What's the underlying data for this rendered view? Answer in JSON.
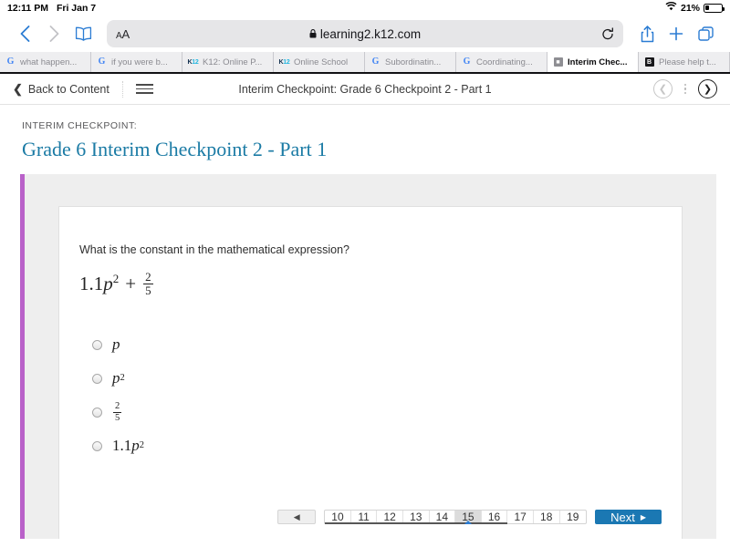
{
  "status_bar": {
    "time": "12:11 PM",
    "date": "Fri Jan 7",
    "wifi_icon": "wifi-icon",
    "battery_percent": "21%"
  },
  "browser": {
    "back_icon": "chevron-left-icon",
    "forward_icon": "chevron-right-icon",
    "bookmarks_icon": "book-icon",
    "reader_label": "AA",
    "lock_icon": "lock-icon",
    "url": "learning2.k12.com",
    "reload_icon": "reload-icon",
    "share_icon": "share-icon",
    "new_tab_icon": "plus-icon",
    "tabs_overview_icon": "tabs-icon",
    "tabs": [
      {
        "label": "what happen...",
        "favicon": "google-icon",
        "active": false
      },
      {
        "label": "if you were b...",
        "favicon": "google-icon",
        "active": false
      },
      {
        "label": "K12: Online P...",
        "favicon": "k12-icon",
        "active": false
      },
      {
        "label": "Online School",
        "favicon": "k12-icon",
        "active": false
      },
      {
        "label": "Subordinatin...",
        "favicon": "google-icon",
        "active": false
      },
      {
        "label": "Coordinating...",
        "favicon": "google-icon",
        "active": false
      },
      {
        "label": "Interim Chec...",
        "favicon": "square-icon",
        "active": true
      },
      {
        "label": "Please help t...",
        "favicon": "square-dark-icon",
        "active": false
      }
    ]
  },
  "app_nav": {
    "back_label": "Back to Content",
    "back_icon": "chevron-left-icon",
    "menu_icon": "hamburger-icon",
    "title": "Interim Checkpoint: Grade 6 Checkpoint 2 - Part 1",
    "prev_icon": "circle-chevron-left-icon",
    "more_icon": "kebab-menu-icon",
    "next_icon": "circle-chevron-right-icon"
  },
  "page_head": {
    "eyebrow": "INTERIM CHECKPOINT:",
    "title": "Grade 6 Interim Checkpoint 2 - Part 1",
    "accent_color": "#b961c9",
    "title_color": "#1b7ba5"
  },
  "question": {
    "prompt": "What is the constant in the mathematical expression?",
    "expression": {
      "coefficient": "1.1",
      "variable": "p",
      "exponent": "2",
      "operator": "+",
      "fraction_numerator": "2",
      "fraction_denominator": "5",
      "plain": "1.1p^2 + 2/5"
    },
    "options": [
      {
        "id": "a",
        "text": "p",
        "kind": "var",
        "selected": false
      },
      {
        "id": "b",
        "text": "p^2",
        "kind": "var-exp",
        "base": "p",
        "exponent": "2",
        "selected": false
      },
      {
        "id": "c",
        "text": "2/5",
        "kind": "fraction",
        "numerator": "2",
        "denominator": "5",
        "selected": false
      },
      {
        "id": "d",
        "text": "1.1p^2",
        "kind": "coef-var-exp",
        "coefficient": "1.1",
        "base": "p",
        "exponent": "2",
        "selected": false
      }
    ]
  },
  "pagination": {
    "prev_icon": "triangle-left-icon",
    "pages": [
      {
        "number": "10",
        "current": false,
        "visited": true
      },
      {
        "number": "11",
        "current": false,
        "visited": true
      },
      {
        "number": "12",
        "current": false,
        "visited": true
      },
      {
        "number": "13",
        "current": false,
        "visited": true
      },
      {
        "number": "14",
        "current": false,
        "visited": true
      },
      {
        "number": "15",
        "current": true,
        "visited": true
      },
      {
        "number": "16",
        "current": false,
        "visited": true
      },
      {
        "number": "17",
        "current": false,
        "visited": false
      },
      {
        "number": "18",
        "current": false,
        "visited": false
      },
      {
        "number": "19",
        "current": false,
        "visited": false
      }
    ],
    "next_label": "Next",
    "next_icon": "triangle-right-icon",
    "next_color": "#1b78b3"
  }
}
